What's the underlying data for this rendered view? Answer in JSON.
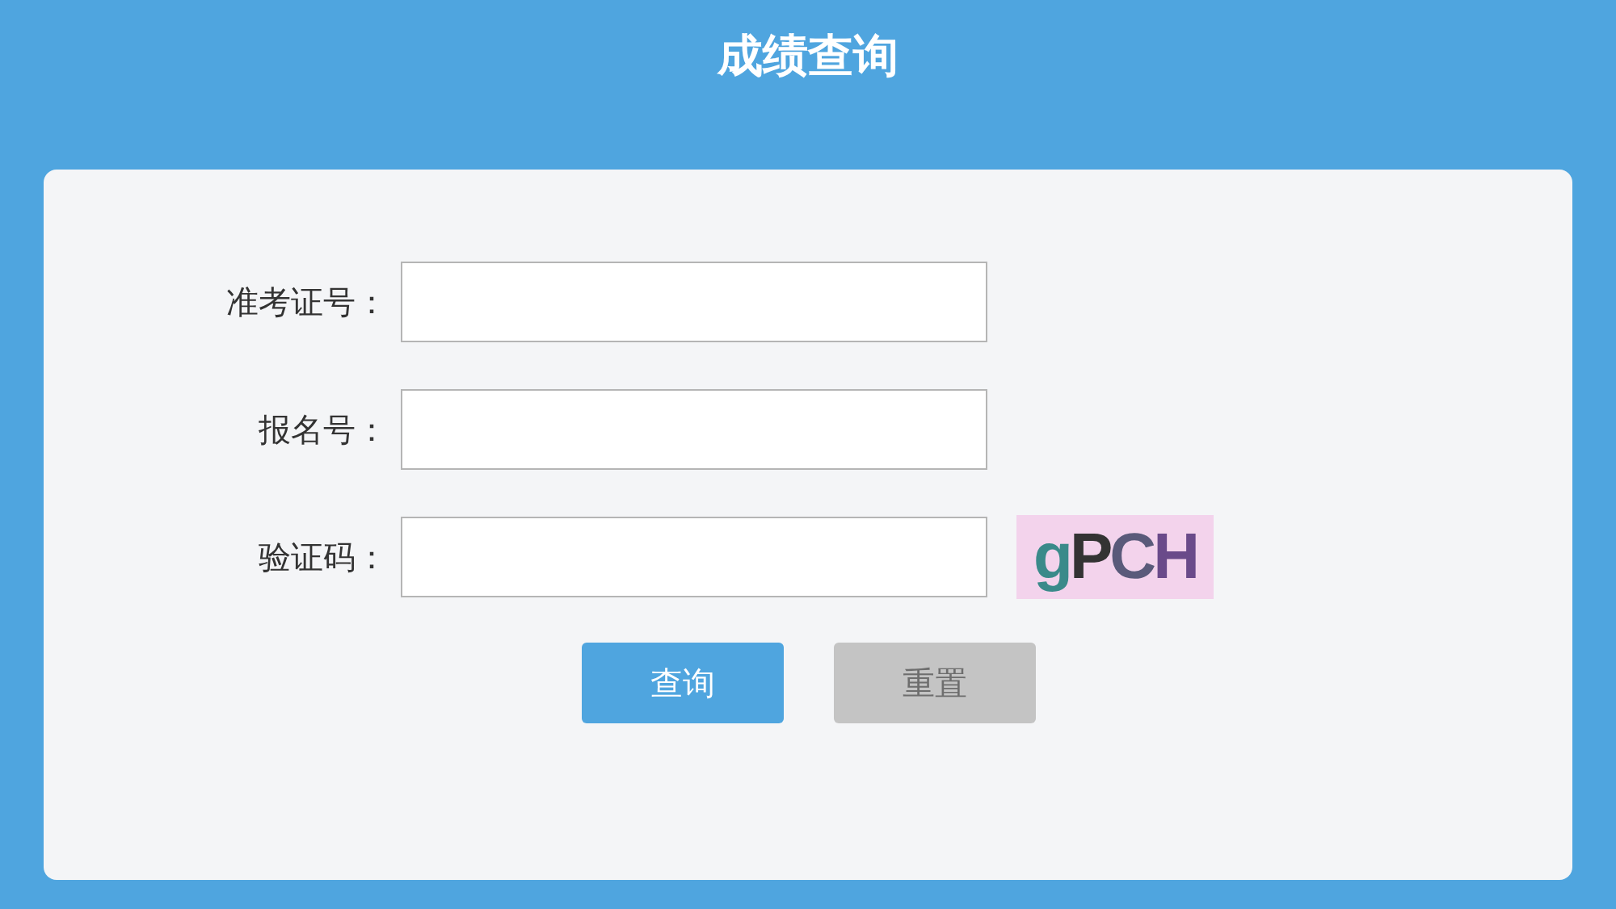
{
  "header": {
    "title": "成绩查询"
  },
  "fields": [
    {
      "label": "准考证号：",
      "kind": "text"
    },
    {
      "label": "报名号：",
      "kind": "text"
    },
    {
      "label": "验证码：",
      "kind": "captcha",
      "captcha": "gPCH"
    }
  ],
  "buttons": [
    {
      "label": "查询",
      "disabled": false
    },
    {
      "label": "重置",
      "disabled": true
    }
  ]
}
